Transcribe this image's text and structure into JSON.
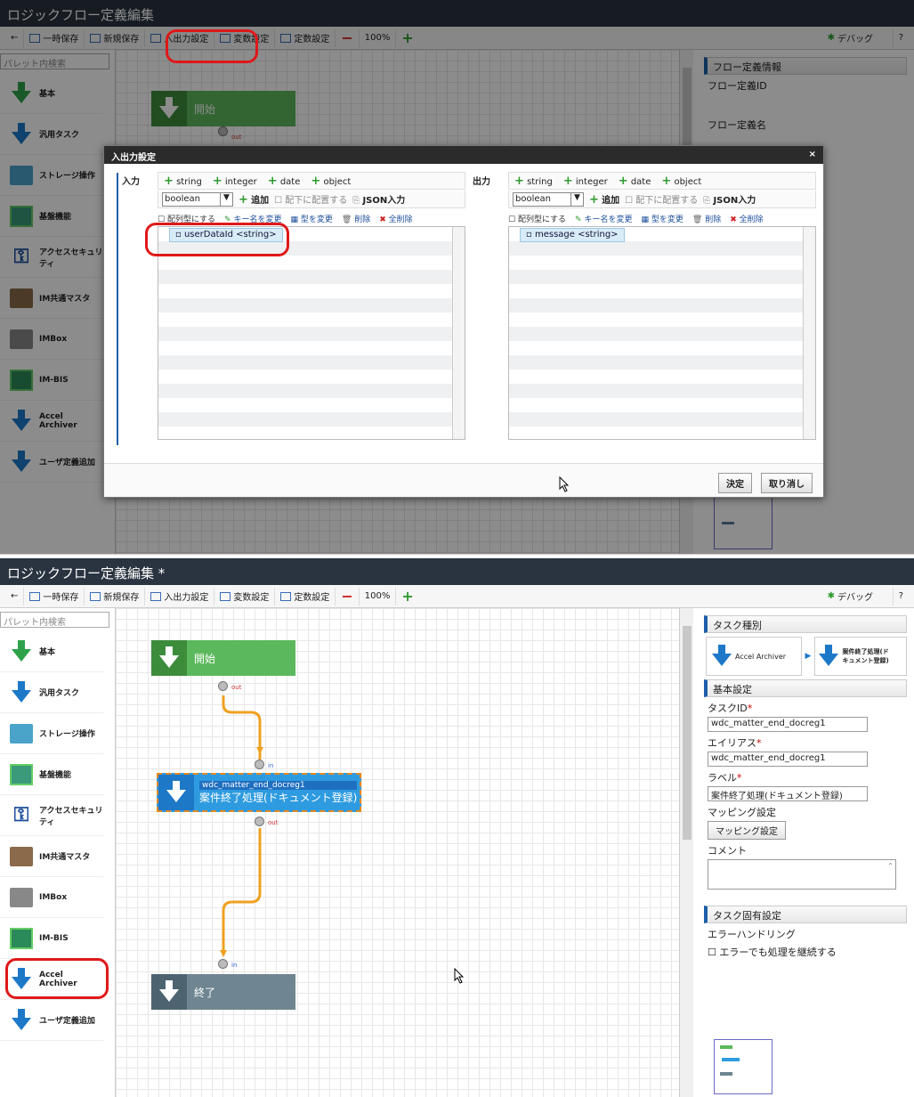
{
  "frame1": {
    "title": "ロジックフロー定義編集",
    "toolbar": {
      "temp_save": "一時保存",
      "new_save": "新規保存",
      "io_settings": "入出力設定",
      "var_settings": "変数設定",
      "const_settings": "定数設定",
      "zoom": "100%",
      "debug": "デバッグ",
      "help": "?"
    },
    "palette": {
      "search_placeholder": "パレット内検索",
      "items": [
        "基本",
        "汎用タスク",
        "ストレージ操作",
        "基盤機能",
        "アクセスセキュリティ",
        "IM共通マスタ",
        "IMBox",
        "IM-BIS",
        "Accel Archiver",
        "ユーザ定義追加"
      ]
    },
    "start_node": "開始",
    "out_label": "out",
    "right": {
      "section": "フロー定義情報",
      "flow_id_label": "フロー定義ID",
      "flow_name_label": "フロー定義名"
    },
    "dialog": {
      "title": "入出力設定",
      "close": "×",
      "input_label": "入力",
      "output_label": "出力",
      "type_buttons": [
        "string",
        "integer",
        "date",
        "object"
      ],
      "select_value": "boolean",
      "add_label": "追加",
      "place_under_label": "配下に配置する",
      "json_input_label": "JSON入力",
      "array_label": "配列型にする",
      "rename_key_label": "キー名を変更",
      "change_type_label": "型を変更",
      "delete_label": "削除",
      "delete_all_label": "全削除",
      "input_node": "userDataId <string>",
      "output_node": "message <string>",
      "ok_button": "決定",
      "cancel_button": "取り消し"
    }
  },
  "frame2": {
    "title": "ロジックフロー定義編集 *",
    "start_node": "開始",
    "end_node": "終了",
    "task_id": "wdc_matter_end_docreg1",
    "task_label": "案件終了処理(ドキュメント登録)",
    "port_out": "out",
    "port_in": "in",
    "right": {
      "task_type_section": "タスク種別",
      "task_type_from": "Accel Archiver",
      "task_type_to": "案件終了処理(ドキュメント登録)",
      "basic_section": "基本設定",
      "task_id_label": "タスクID",
      "task_id_value": "wdc_matter_end_docreg1",
      "alias_label": "エイリアス",
      "alias_value": "wdc_matter_end_docreg1",
      "label_label": "ラベル",
      "label_value": "案件終了処理(ドキュメント登録)",
      "mapping_label": "マッピング設定",
      "mapping_button": "マッピング設定",
      "comment_label": "コメント",
      "specific_section": "タスク固有設定",
      "error_handling_label": "エラーハンドリング",
      "continue_on_error": "エラーでも処理を継続する",
      "required_mark": "*"
    }
  },
  "colors": {
    "titlebar": "#2a3440",
    "accent_blue": "#1d78c8",
    "start_green": "#5cb85c",
    "end_grey": "#6f8591",
    "highlight_red": "#e01818",
    "connector": "#f0a020"
  }
}
